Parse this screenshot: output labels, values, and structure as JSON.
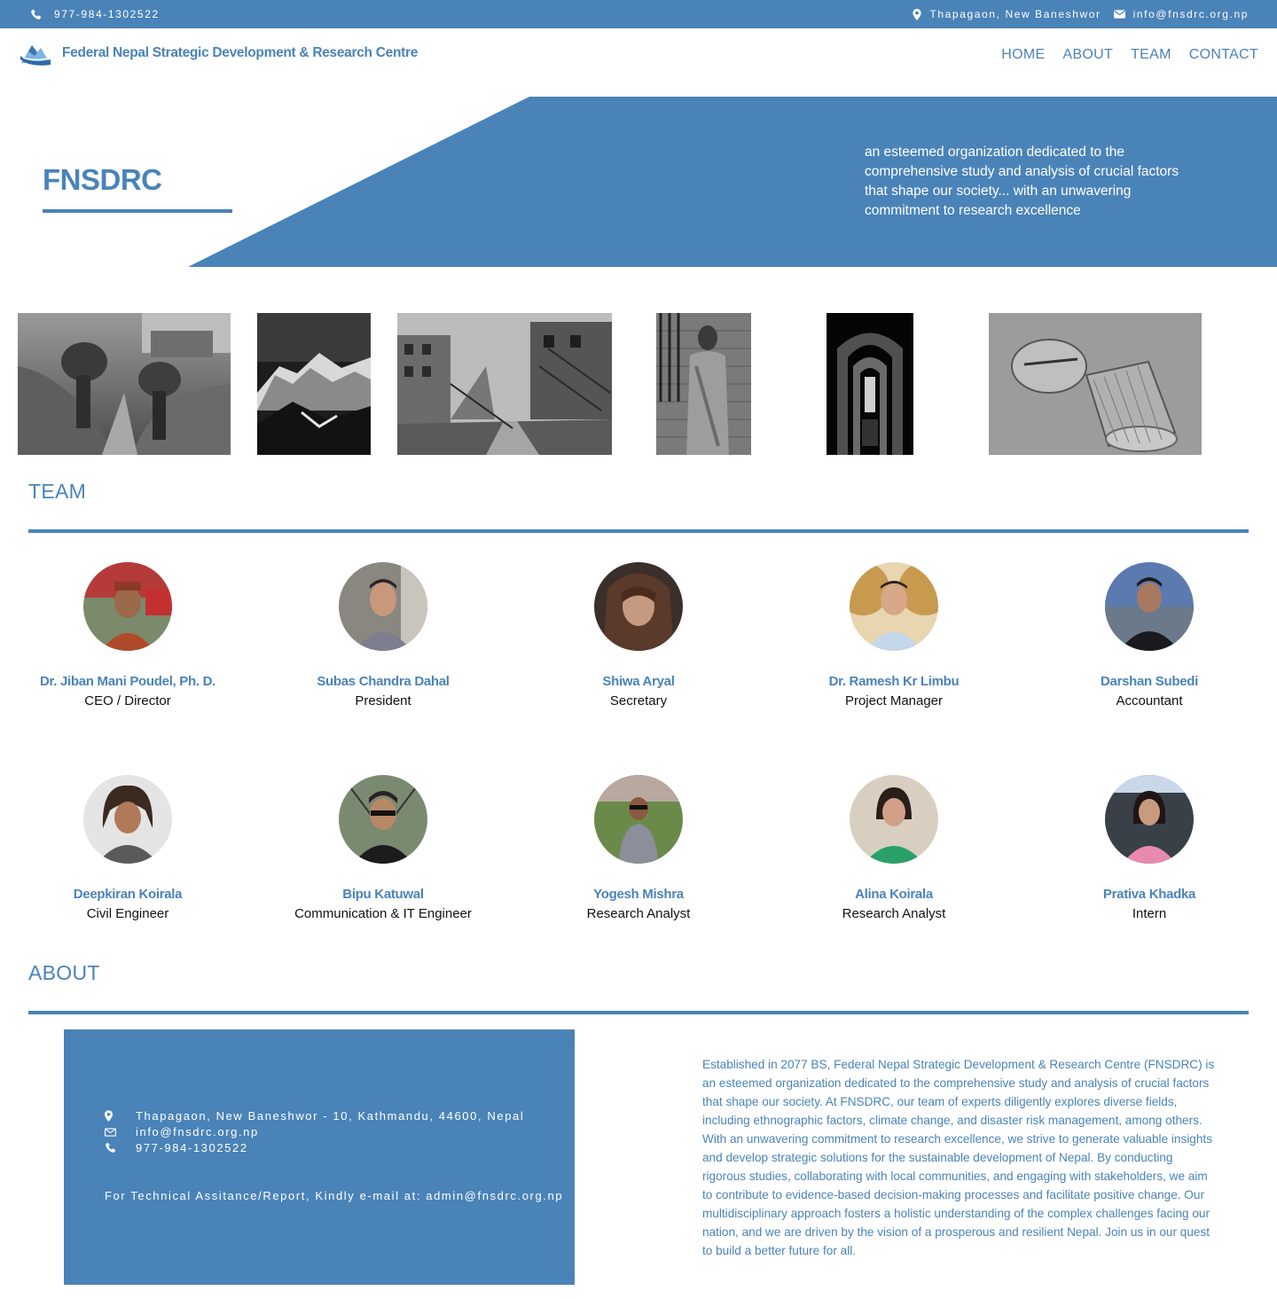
{
  "topbar": {
    "phone": "977-984-1302522",
    "address": "Thapagaon, New Baneshwor",
    "email": "info@fnsdrc.org.np"
  },
  "header": {
    "brand": "Federal Nepal Strategic Development & Research Centre",
    "nav": [
      "HOME",
      "ABOUT",
      "TEAM",
      "CONTACT"
    ]
  },
  "hero": {
    "title": "FNSDRC",
    "tagline": "an esteemed organization dedicated to the comprehensive study and analysis of crucial factors that shape our society... with an unwavering commitment to research excellence"
  },
  "team": {
    "heading": "TEAM",
    "members": [
      {
        "name": "Dr. Jiban Mani Poudel, Ph. D.",
        "role": "CEO / Director"
      },
      {
        "name": "Subas Chandra Dahal",
        "role": "President"
      },
      {
        "name": "Shiwa Aryal",
        "role": "Secretary"
      },
      {
        "name": "Dr. Ramesh Kr Limbu",
        "role": "Project Manager"
      },
      {
        "name": "Darshan Subedi",
        "role": "Accountant"
      },
      {
        "name": "Deepkiran Koirala",
        "role": "Civil Engineer"
      },
      {
        "name": "Bipu Katuwal",
        "role": "Communication & IT Engineer"
      },
      {
        "name": "Yogesh Mishra",
        "role": "Research Analyst"
      },
      {
        "name": "Alina Koirala",
        "role": "Research Analyst"
      },
      {
        "name": "Prativa Khadka",
        "role": "Intern"
      }
    ]
  },
  "about": {
    "heading": "ABOUT",
    "address": "Thapagaon, New Baneshwor - 10, Kathmandu, 44600, Nepal",
    "email": "info@fnsdrc.org.np",
    "phone": "977-984-1302522",
    "note": "For Technical Assitance/Report, Kindly e-mail at: admin@fnsdrc.org.np",
    "text": "Established in 2077 BS, Federal Nepal Strategic Development & Research Centre (FNSDRC) is an esteemed organization dedicated to the comprehensive study and analysis of crucial factors that shape our society. At FNSDRC, our team of experts diligently explores diverse fields, including ethnographic factors, climate change, and disaster risk management, among others. With an unwavering commitment to research excellence, we strive to generate valuable insights and develop strategic solutions for the sustainable development of Nepal. By conducting rigorous studies, collaborating with local communities, and engaging with stakeholders, we aim to contribute to evidence-based decision-making processes and facilitate positive change. Our multidisciplinary approach fosters a holistic understanding of the complex challenges facing our nation, and we are driven by the vision of a prosperous and resilient Nepal. Join us in our quest to build a better future for all."
  },
  "colors": {
    "brand": "#4a83b8",
    "background": "#ffffff"
  }
}
